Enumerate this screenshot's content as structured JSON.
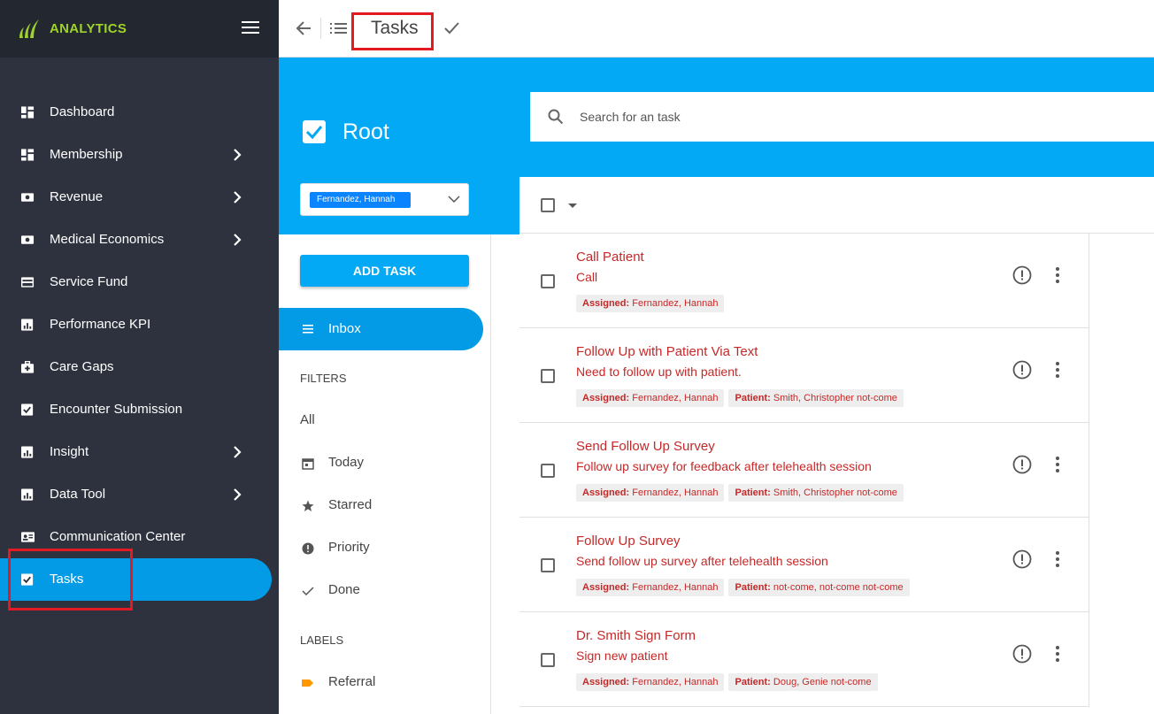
{
  "brand": {
    "name": "ANALYTICS",
    "color": "#9fd32b"
  },
  "sidebar": {
    "items": [
      {
        "label": "Dashboard",
        "icon": "dashboard-icon",
        "has_submenu": false
      },
      {
        "label": "Membership",
        "icon": "dashboard-icon",
        "has_submenu": true
      },
      {
        "label": "Revenue",
        "icon": "money-icon",
        "has_submenu": true
      },
      {
        "label": "Medical Economics",
        "icon": "money-icon",
        "has_submenu": true
      },
      {
        "label": "Service Fund",
        "icon": "credit-card-icon",
        "has_submenu": false
      },
      {
        "label": "Performance KPI",
        "icon": "chart-icon",
        "has_submenu": false
      },
      {
        "label": "Care Gaps",
        "icon": "medical-kit-icon",
        "has_submenu": false
      },
      {
        "label": "Encounter Submission",
        "icon": "check-box-icon",
        "has_submenu": false
      },
      {
        "label": "Insight",
        "icon": "chart-icon",
        "has_submenu": true
      },
      {
        "label": "Data Tool",
        "icon": "chart-icon",
        "has_submenu": true
      },
      {
        "label": "Communication Center",
        "icon": "contact-card-icon",
        "has_submenu": false
      },
      {
        "label": "Tasks",
        "icon": "check-box-icon",
        "has_submenu": false,
        "active": true
      }
    ]
  },
  "toolbar": {
    "title": "Tasks"
  },
  "panel": {
    "root_title": "Root",
    "selected_user": "Fernandez, Hannah",
    "add_task_label": "ADD TASK",
    "inbox_label": "Inbox",
    "filters_heading": "FILTERS",
    "filters": [
      {
        "label": "All",
        "icon": ""
      },
      {
        "label": "Today",
        "icon": "calendar-icon"
      },
      {
        "label": "Starred",
        "icon": "star-icon"
      },
      {
        "label": "Priority",
        "icon": "priority-icon"
      },
      {
        "label": "Done",
        "icon": "check-icon"
      }
    ],
    "labels_heading": "LABELS",
    "labels": [
      {
        "label": "Referral",
        "color": "#ff9800"
      }
    ]
  },
  "search": {
    "placeholder": "Search for an task"
  },
  "tasks": [
    {
      "title": "Call Patient",
      "description": "Call",
      "assigned_label": "Assigned:",
      "assigned": "Fernandez, Hannah",
      "patient_label": "",
      "patient": ""
    },
    {
      "title": "Follow Up with Patient Via Text",
      "description": "Need to follow up with patient.",
      "assigned_label": "Assigned:",
      "assigned": "Fernandez, Hannah",
      "patient_label": "Patient:",
      "patient": "Smith, Christopher not-come"
    },
    {
      "title": "Send Follow Up Survey",
      "description": "Follow up survey for feedback after telehealth session",
      "assigned_label": "Assigned:",
      "assigned": "Fernandez, Hannah",
      "patient_label": "Patient:",
      "patient": "Smith, Christopher not-come"
    },
    {
      "title": "Follow Up Survey",
      "description": "Send follow up survey after telehealth session",
      "assigned_label": "Assigned:",
      "assigned": "Fernandez, Hannah",
      "patient_label": "Patient:",
      "patient": "not-come, not-come not-come"
    },
    {
      "title": "Dr. Smith Sign Form",
      "description": "Sign new patient",
      "assigned_label": "Assigned:",
      "assigned": "Fernandez, Hannah",
      "patient_label": "Patient:",
      "patient": "Doug, Genie not-come"
    }
  ],
  "colors": {
    "accent": "#03a9f4",
    "sidebar_bg": "#2d323e",
    "task_text": "#c62828",
    "highlight_box": "#e21b23"
  }
}
